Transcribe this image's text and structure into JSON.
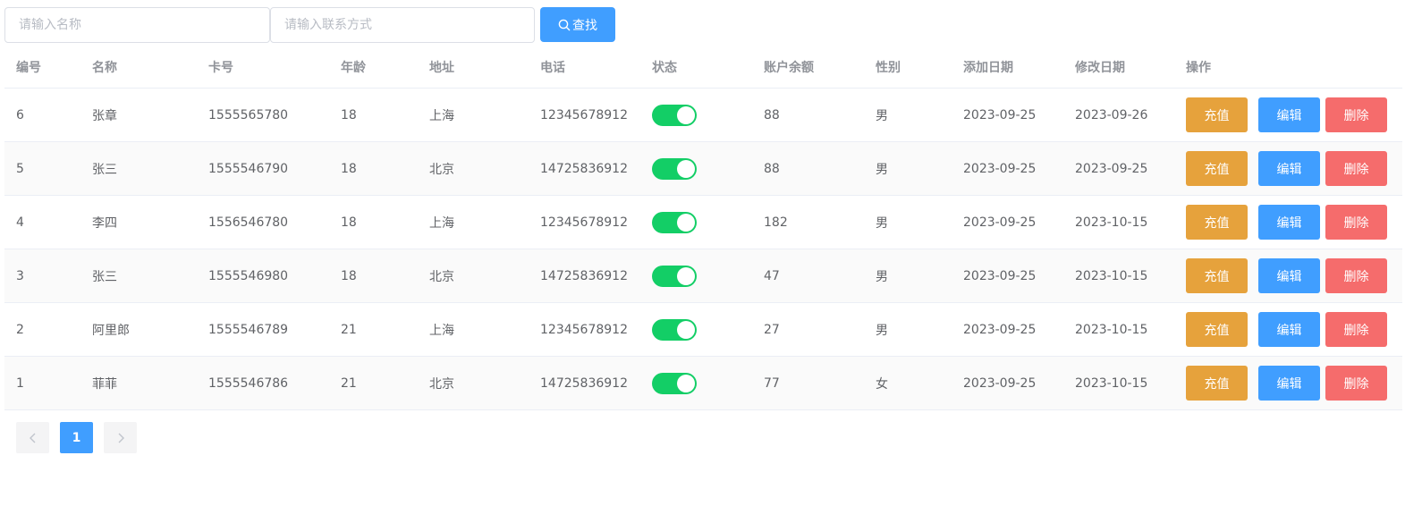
{
  "search": {
    "name_placeholder": "请输入名称",
    "contact_placeholder": "请输入联系方式",
    "button_label": "查找"
  },
  "table": {
    "columns": [
      "编号",
      "名称",
      "卡号",
      "年龄",
      "地址",
      "电话",
      "状态",
      "账户余额",
      "性别",
      "添加日期",
      "修改日期",
      "操作"
    ],
    "rows": [
      {
        "id": "6",
        "name": "张章",
        "card": "1555565780",
        "age": "18",
        "address": "上海",
        "phone": "12345678912",
        "status_on": true,
        "balance": "88",
        "gender": "男",
        "added": "2023-09-25",
        "modified": "2023-09-26"
      },
      {
        "id": "5",
        "name": "张三",
        "card": "1555546790",
        "age": "18",
        "address": "北京",
        "phone": "14725836912",
        "status_on": true,
        "balance": "88",
        "gender": "男",
        "added": "2023-09-25",
        "modified": "2023-09-25"
      },
      {
        "id": "4",
        "name": "李四",
        "card": "1556546780",
        "age": "18",
        "address": "上海",
        "phone": "12345678912",
        "status_on": true,
        "balance": "182",
        "gender": "男",
        "added": "2023-09-25",
        "modified": "2023-10-15"
      },
      {
        "id": "3",
        "name": "张三",
        "card": "1555546980",
        "age": "18",
        "address": "北京",
        "phone": "14725836912",
        "status_on": true,
        "balance": "47",
        "gender": "男",
        "added": "2023-09-25",
        "modified": "2023-10-15"
      },
      {
        "id": "2",
        "name": "阿里郎",
        "card": "1555546789",
        "age": "21",
        "address": "上海",
        "phone": "12345678912",
        "status_on": true,
        "balance": "27",
        "gender": "男",
        "added": "2023-09-25",
        "modified": "2023-10-15"
      },
      {
        "id": "1",
        "name": "菲菲",
        "card": "1555546786",
        "age": "21",
        "address": "北京",
        "phone": "14725836912",
        "status_on": true,
        "balance": "77",
        "gender": "女",
        "added": "2023-09-25",
        "modified": "2023-10-15"
      }
    ],
    "actions": {
      "recharge": "充值",
      "edit": "编辑",
      "delete": "删除"
    }
  },
  "pagination": {
    "current_page": "1",
    "prev_icon": "chevron-left-icon",
    "next_icon": "chevron-right-icon"
  },
  "colors": {
    "primary": "#409eff",
    "warning": "#e6a23c",
    "danger": "#f56c6c",
    "switch_on": "#13ce66"
  }
}
